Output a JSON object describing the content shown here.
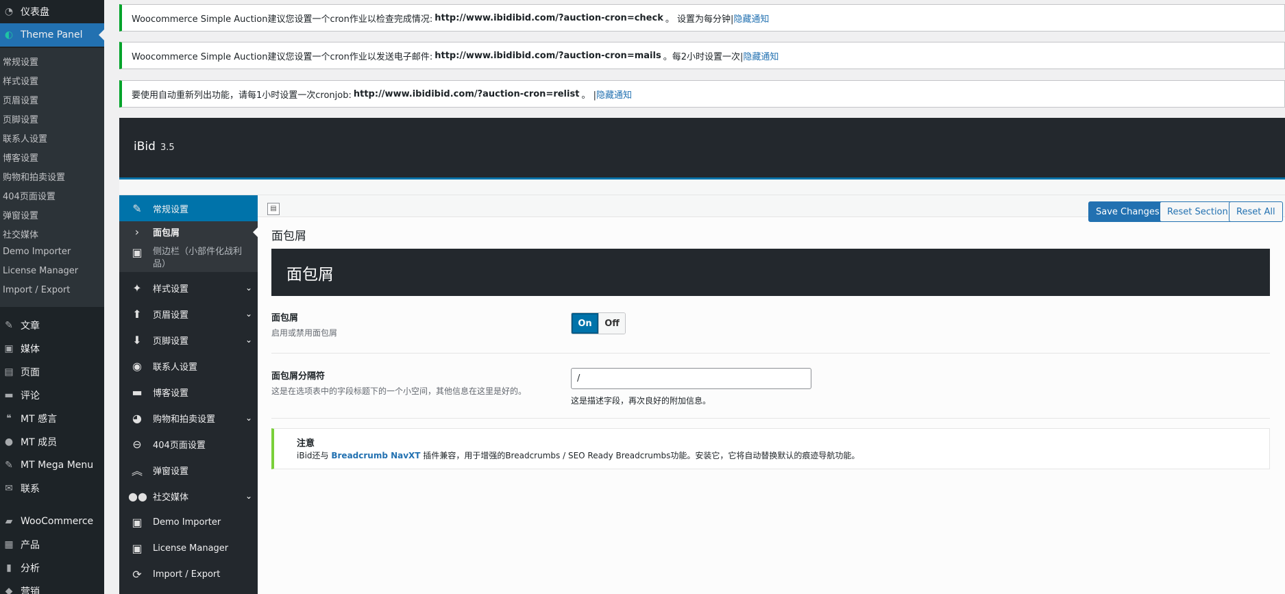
{
  "wp_menu": {
    "dashboard": "仪表盘",
    "theme_panel": "Theme Panel",
    "submenu": [
      "常规设置",
      "样式设置",
      "页眉设置",
      "页脚设置",
      "联系人设置",
      "博客设置",
      "购物和拍卖设置",
      "404页面设置",
      "弹窗设置",
      "社交媒体",
      "Demo Importer",
      "License Manager",
      "Import / Export"
    ],
    "items": [
      {
        "label": "文章",
        "icon": "pin-icon"
      },
      {
        "label": "媒体",
        "icon": "media-icon"
      },
      {
        "label": "页面",
        "icon": "page-icon"
      },
      {
        "label": "评论",
        "icon": "comment-icon"
      },
      {
        "label": "MT 感言",
        "icon": "testimonial-icon"
      },
      {
        "label": "MT 成员",
        "icon": "members-icon"
      },
      {
        "label": "MT Mega Menu",
        "icon": "pin-icon"
      },
      {
        "label": "联系",
        "icon": "mail-icon"
      },
      {
        "label": "WooCommerce",
        "icon": "woocommerce-icon"
      },
      {
        "label": "产品",
        "icon": "products-icon"
      },
      {
        "label": "分析",
        "icon": "analytics-icon"
      },
      {
        "label": "营销",
        "icon": "marketing-icon"
      }
    ]
  },
  "notices": [
    {
      "pre": "Woocommerce Simple Auction建议您设置一个cron作业以检查完成情况:",
      "url": "http://www.ibidibid.com/?auction-cron=check",
      "post": "。 设置为每分钟|",
      "link": "隐藏通知"
    },
    {
      "pre": "Woocommerce Simple Auction建议您设置一个cron作业以发送电子邮件:",
      "url": "http://www.ibidibid.com/?auction-cron=mails",
      "post": "。每2小时设置一次|",
      "link": "隐藏通知"
    },
    {
      "pre": "要使用自动重新列出功能，请每1小时设置一次cronjob:",
      "url": "http://www.ibidibid.com/?auction-cron=relist",
      "post": "。 |",
      "link": "隐藏通知"
    }
  ],
  "panel": {
    "name": "iBid",
    "version": "3.5"
  },
  "redux_nav": [
    {
      "label": "常规设置",
      "icon": "wrench-icon",
      "state": "active"
    },
    {
      "label": "面包屑",
      "icon": "chevron-right-icon",
      "state": "current"
    },
    {
      "label": "侧边栏（小部件化战利品）",
      "icon": "widget-icon",
      "state": "child"
    },
    {
      "label": "样式设置",
      "icon": "magic-wand-icon",
      "chevron": true
    },
    {
      "label": "页眉设置",
      "icon": "arrow-up-icon",
      "chevron": true
    },
    {
      "label": "页脚设置",
      "icon": "arrow-down-icon",
      "chevron": true
    },
    {
      "label": "联系人设置",
      "icon": "location-icon"
    },
    {
      "label": "博客设置",
      "icon": "chat-icon"
    },
    {
      "label": "购物和拍卖设置",
      "icon": "cart-icon",
      "chevron": true
    },
    {
      "label": "404页面设置",
      "icon": "minus-circle-icon"
    },
    {
      "label": "弹窗设置",
      "icon": "double-chevron-up-icon"
    },
    {
      "label": "社交媒体",
      "icon": "users-icon",
      "chevron": true
    },
    {
      "label": "Demo Importer",
      "icon": "widget-icon"
    },
    {
      "label": "License Manager",
      "icon": "widget-icon"
    },
    {
      "label": "Import / Export",
      "icon": "refresh-icon"
    }
  ],
  "toolbar": {
    "save": "Save Changes",
    "reset_section": "Reset Section",
    "reset_all": "Reset All"
  },
  "section": {
    "title": "面包屑",
    "banner": "面包屑",
    "fields": {
      "toggle_label": "面包屑",
      "toggle_desc": "启用或禁用面包屑",
      "toggle_on": "On",
      "toggle_off": "Off",
      "toggle_value": true,
      "separator_label": "面包屑分隔符",
      "separator_desc": "这是在选项表中的字段标题下的一个小空间，其他信息在这里是好的。",
      "separator_value": "/",
      "separator_note": "这是描述字段，再次良好的附加信息。"
    },
    "info": {
      "title": "注意",
      "pre": "iBid还与",
      "link": "Breadcrumb NavXT",
      "post": "插件兼容，用于增强的Breadcrumbs / SEO Ready Breadcrumbs功能。安装它，它将自动替换默认的痕迹导航功能。"
    }
  }
}
